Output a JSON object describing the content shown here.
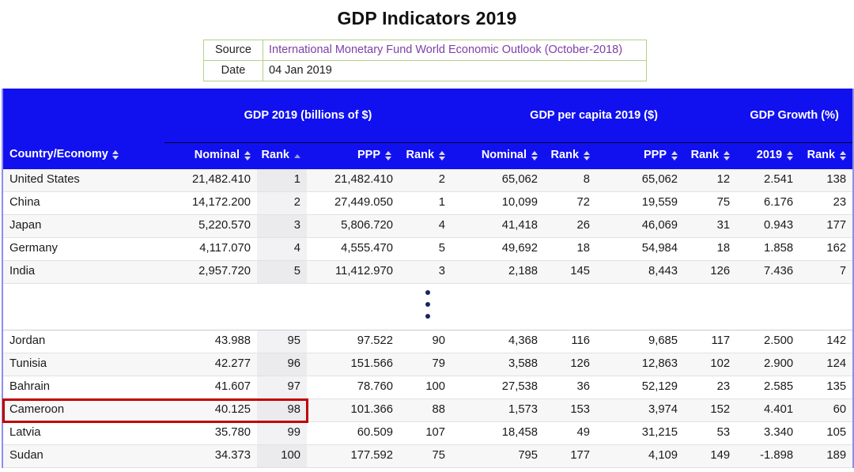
{
  "page": {
    "title": "GDP Indicators 2019"
  },
  "meta": {
    "source_label": "Source",
    "source_value": "International Monetary Fund World Economic Outlook (October-2018)",
    "date_label": "Date",
    "date_value": "04 Jan 2019"
  },
  "table": {
    "group_headers": [
      {
        "label": "Country/Economy",
        "sort": "both"
      },
      {
        "label": "GDP 2019 (billions of $)",
        "sort": "none"
      },
      {
        "label": "GDP per capita 2019 ($)",
        "sort": "none"
      },
      {
        "label": "GDP Growth (%)",
        "sort": "none"
      }
    ],
    "sub_headers": [
      {
        "label": "Nominal",
        "sort": "both"
      },
      {
        "label": "Rank",
        "sort": "asc"
      },
      {
        "label": "PPP",
        "sort": "both"
      },
      {
        "label": "Rank",
        "sort": "both"
      },
      {
        "label": "Nominal",
        "sort": "both"
      },
      {
        "label": "Rank",
        "sort": "both"
      },
      {
        "label": "PPP",
        "sort": "both"
      },
      {
        "label": "Rank",
        "sort": "both"
      },
      {
        "label": "2019",
        "sort": "both"
      },
      {
        "label": "Rank",
        "sort": "both"
      }
    ],
    "sorted_column_index": 2,
    "rows_top": [
      {
        "country": "United States",
        "gdp_nominal": "21,482.410",
        "gdp_nominal_rank": "1",
        "gdp_ppp": "21,482.410",
        "gdp_ppp_rank": "2",
        "pc_nominal": "65,062",
        "pc_nominal_rank": "8",
        "pc_ppp": "65,062",
        "pc_ppp_rank": "12",
        "growth": "2.541",
        "growth_rank": "138"
      },
      {
        "country": "China",
        "gdp_nominal": "14,172.200",
        "gdp_nominal_rank": "2",
        "gdp_ppp": "27,449.050",
        "gdp_ppp_rank": "1",
        "pc_nominal": "10,099",
        "pc_nominal_rank": "72",
        "pc_ppp": "19,559",
        "pc_ppp_rank": "75",
        "growth": "6.176",
        "growth_rank": "23"
      },
      {
        "country": "Japan",
        "gdp_nominal": "5,220.570",
        "gdp_nominal_rank": "3",
        "gdp_ppp": "5,806.720",
        "gdp_ppp_rank": "4",
        "pc_nominal": "41,418",
        "pc_nominal_rank": "26",
        "pc_ppp": "46,069",
        "pc_ppp_rank": "31",
        "growth": "0.943",
        "growth_rank": "177"
      },
      {
        "country": "Germany",
        "gdp_nominal": "4,117.070",
        "gdp_nominal_rank": "4",
        "gdp_ppp": "4,555.470",
        "gdp_ppp_rank": "5",
        "pc_nominal": "49,692",
        "pc_nominal_rank": "18",
        "pc_ppp": "54,984",
        "pc_ppp_rank": "18",
        "growth": "1.858",
        "growth_rank": "162"
      },
      {
        "country": "India",
        "gdp_nominal": "2,957.720",
        "gdp_nominal_rank": "5",
        "gdp_ppp": "11,412.970",
        "gdp_ppp_rank": "3",
        "pc_nominal": "2,188",
        "pc_nominal_rank": "145",
        "pc_ppp": "8,443",
        "pc_ppp_rank": "126",
        "growth": "7.436",
        "growth_rank": "7"
      }
    ],
    "rows_bottom": [
      {
        "country": "Jordan",
        "gdp_nominal": "43.988",
        "gdp_nominal_rank": "95",
        "gdp_ppp": "97.522",
        "gdp_ppp_rank": "90",
        "pc_nominal": "4,368",
        "pc_nominal_rank": "116",
        "pc_ppp": "9,685",
        "pc_ppp_rank": "117",
        "growth": "2.500",
        "growth_rank": "142"
      },
      {
        "country": "Tunisia",
        "gdp_nominal": "42.277",
        "gdp_nominal_rank": "96",
        "gdp_ppp": "151.566",
        "gdp_ppp_rank": "79",
        "pc_nominal": "3,588",
        "pc_nominal_rank": "126",
        "pc_ppp": "12,863",
        "pc_ppp_rank": "102",
        "growth": "2.900",
        "growth_rank": "124"
      },
      {
        "country": "Bahrain",
        "gdp_nominal": "41.607",
        "gdp_nominal_rank": "97",
        "gdp_ppp": "78.760",
        "gdp_ppp_rank": "100",
        "pc_nominal": "27,538",
        "pc_nominal_rank": "36",
        "pc_ppp": "52,129",
        "pc_ppp_rank": "23",
        "growth": "2.585",
        "growth_rank": "135"
      },
      {
        "country": "Cameroon",
        "gdp_nominal": "40.125",
        "gdp_nominal_rank": "98",
        "gdp_ppp": "101.366",
        "gdp_ppp_rank": "88",
        "pc_nominal": "1,573",
        "pc_nominal_rank": "153",
        "pc_ppp": "3,974",
        "pc_ppp_rank": "152",
        "growth": "4.401",
        "growth_rank": "60"
      },
      {
        "country": "Latvia",
        "gdp_nominal": "35.780",
        "gdp_nominal_rank": "99",
        "gdp_ppp": "60.509",
        "gdp_ppp_rank": "107",
        "pc_nominal": "18,458",
        "pc_nominal_rank": "49",
        "pc_ppp": "31,215",
        "pc_ppp_rank": "53",
        "growth": "3.340",
        "growth_rank": "105"
      },
      {
        "country": "Sudan",
        "gdp_nominal": "34.373",
        "gdp_nominal_rank": "100",
        "gdp_ppp": "177.592",
        "gdp_ppp_rank": "75",
        "pc_nominal": "795",
        "pc_nominal_rank": "177",
        "pc_ppp": "4,109",
        "pc_ppp_rank": "149",
        "growth": "-1.898",
        "growth_rank": "189"
      }
    ],
    "highlight": {
      "country": "Cameroon",
      "color": "#c00000"
    },
    "ellipsis_glyph": "vertical-ellipsis"
  },
  "colors": {
    "header_blue": "#1111f0",
    "meta_border_green": "#b5d08a",
    "source_link_purple": "#7d3fa8",
    "highlight_red": "#c00000",
    "dot_navy": "#17265e"
  }
}
